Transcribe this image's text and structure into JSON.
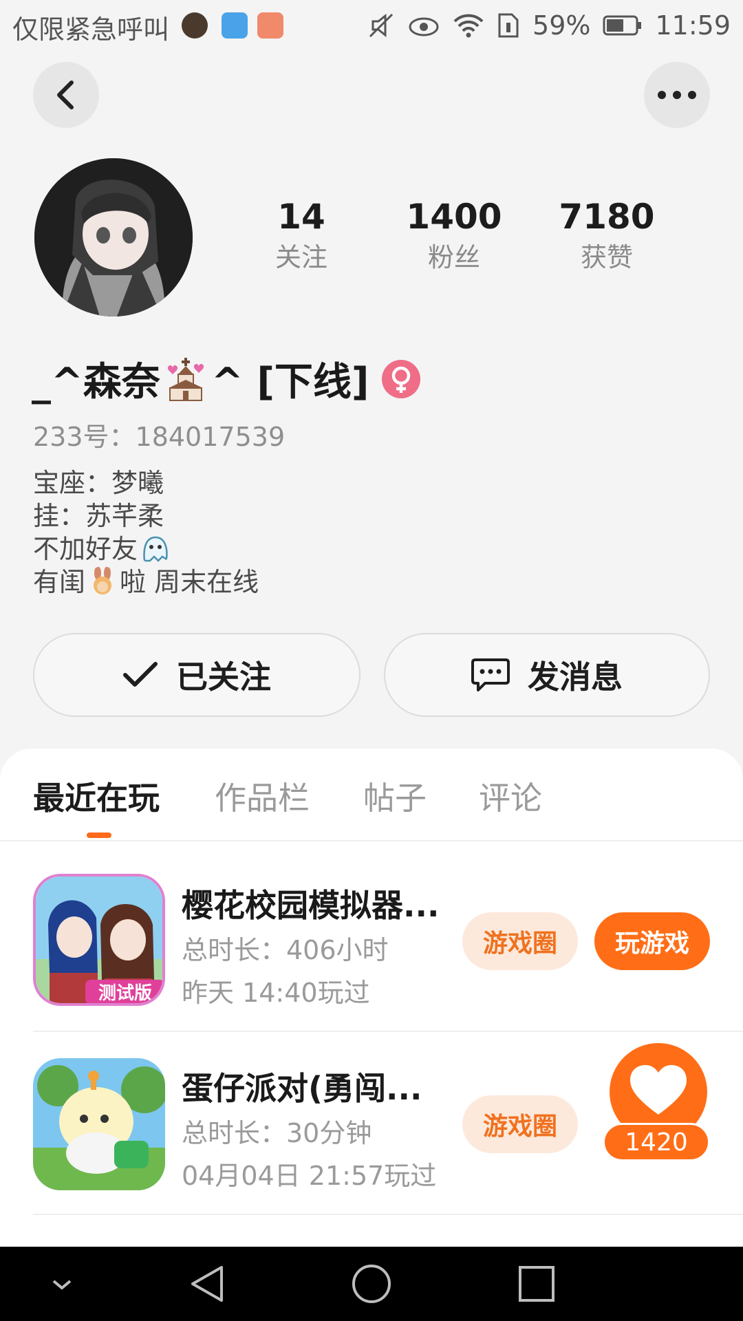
{
  "status_bar": {
    "carrier": "仅限紧急呼叫",
    "battery": "59%",
    "time": "11:59"
  },
  "profile": {
    "stats": [
      {
        "value": "14",
        "label": "关注"
      },
      {
        "value": "1400",
        "label": "粉丝"
      },
      {
        "value": "7180",
        "label": "获赞"
      }
    ],
    "name_prefix": "_^森奈",
    "name_suffix": "^  [下线]",
    "uid": "233号：184017539",
    "bio": [
      "宝座：梦曦",
      "挂：苏芊柔",
      "不加好友",
      "有闺",
      "啦  周末在线"
    ],
    "follow_label": "已关注",
    "message_label": "发消息"
  },
  "tabs": [
    "最近在玩",
    "作品栏",
    "帖子",
    "评论"
  ],
  "games": [
    {
      "title": "樱花校园模拟器...",
      "duration": "总时长：406小时",
      "last_played": "昨天 14:40玩过",
      "circle_label": "游戏圈",
      "play_label": "玩游戏",
      "icon_badge": "测试版"
    },
    {
      "title": "蛋仔派对(勇闯...",
      "duration": "总时长：30分钟",
      "last_played": "04月04日 21:57玩过",
      "circle_label": "游戏圈"
    }
  ],
  "like_badge": {
    "count": "1420"
  },
  "colors": {
    "accent": "#ff6e17",
    "accent_soft": "#fde9dc",
    "gender_female": "#ef6d87"
  }
}
